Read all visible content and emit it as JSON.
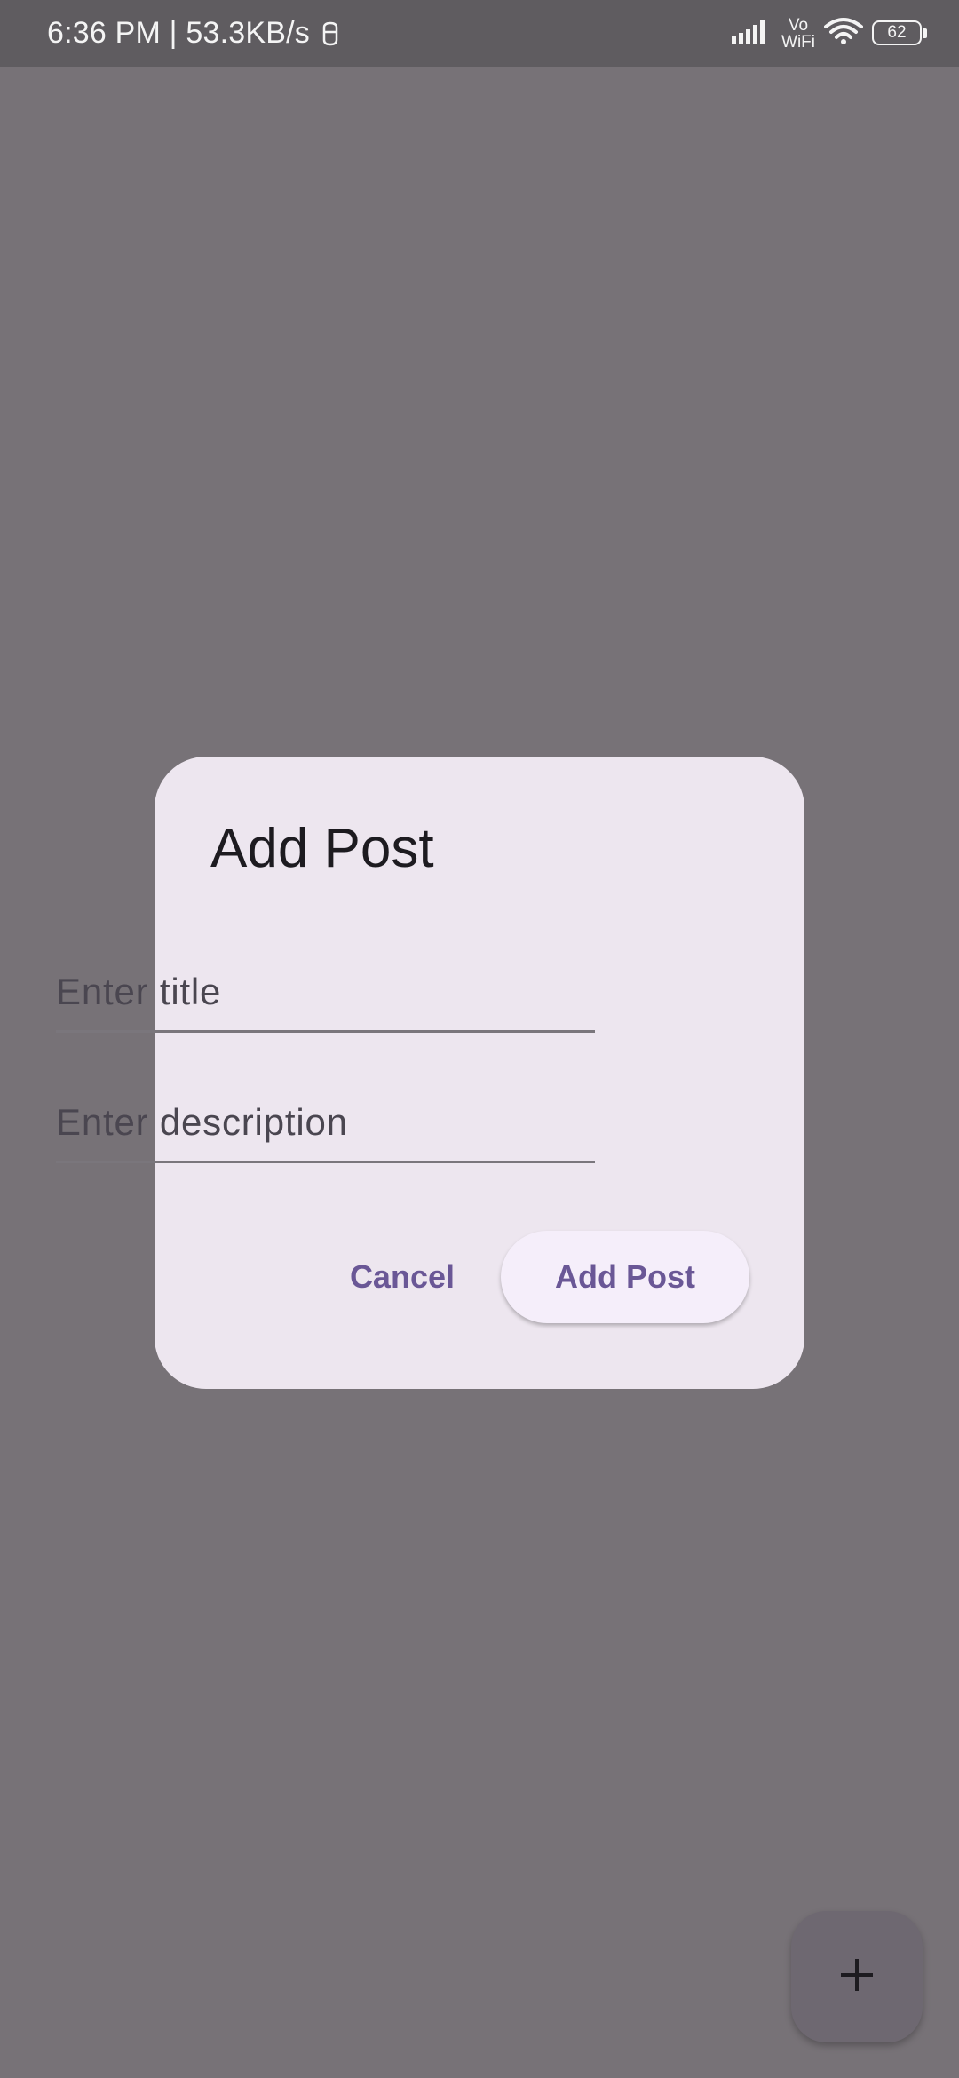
{
  "status_bar": {
    "time_speed": "6:36 PM | 53.3KB/s",
    "vowifi_top": "Vo",
    "vowifi_bottom": "WiFi",
    "battery_level": "62",
    "icons": [
      "notification-icon",
      "signal-icon",
      "wifi-icon",
      "battery-icon"
    ]
  },
  "dialog": {
    "title": "Add Post",
    "title_field": {
      "placeholder": "Enter title",
      "value": ""
    },
    "description_field": {
      "placeholder": "Enter description",
      "value": ""
    },
    "cancel_label": "Cancel",
    "submit_label": "Add Post"
  },
  "fab": {
    "icon": "plus-icon"
  },
  "colors": {
    "scrim": "#777277",
    "dialog_bg": "#ede6ef",
    "accent": "#6a5796",
    "status_bar": "#5f5c60"
  }
}
